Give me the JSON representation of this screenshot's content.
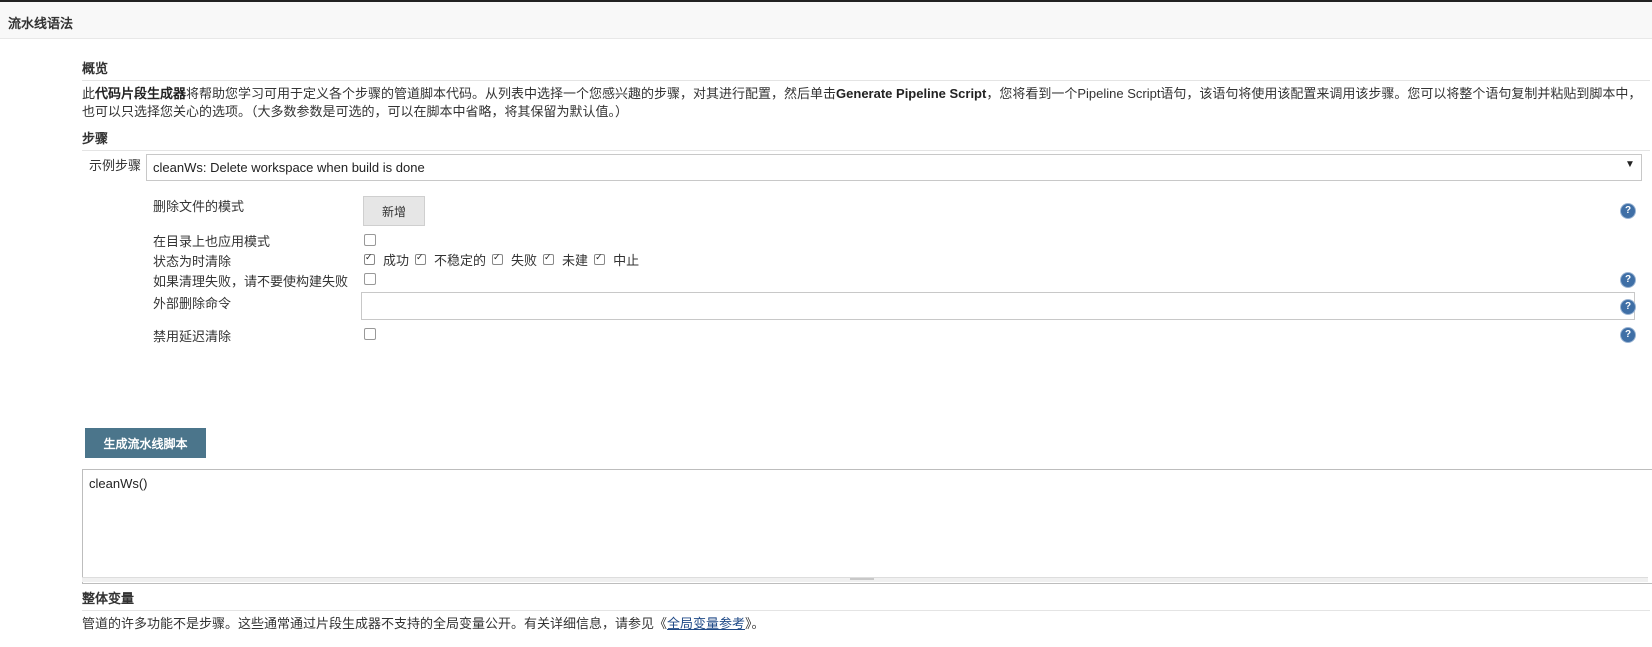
{
  "header": {
    "title": "流水线语法"
  },
  "overview": {
    "title": "概览",
    "text_pre": "此",
    "text_bold1": "代码片段生成器",
    "text_mid": "将帮助您学习可用于定义各个步骤的管道脚本代码。从列表中选择一个您感兴趣的步骤，对其进行配置，然后单击",
    "text_bold2": "Generate Pipeline Script",
    "text_post": "，您将看到一个Pipeline Script语句，该语句将使用该配置来调用该步骤。您可以将整个语句复制并粘贴到脚本中，也可以只选择您关心的选项。（大多数参数是可选的，可以在脚本中省略，将其保留为默认值。）"
  },
  "steps": {
    "title": "步骤",
    "sample_label": "示例步骤",
    "selected_step": "cleanWs: Delete workspace when build is done"
  },
  "form": {
    "patterns_label": "删除文件的模式",
    "add_button": "新增",
    "apply_dirs_label": "在目录上也应用模式",
    "apply_dirs_checked": false,
    "clean_when_label": "状态为时清除",
    "statuses": [
      {
        "label": "成功",
        "checked": true
      },
      {
        "label": "不稳定的",
        "checked": true
      },
      {
        "label": "失败",
        "checked": true
      },
      {
        "label": "未建",
        "checked": true
      },
      {
        "label": "中止",
        "checked": true
      }
    ],
    "not_fail_label": "如果清理失败，请不要使构建失败",
    "not_fail_checked": false,
    "external_cmd_label": "外部删除命令",
    "external_cmd_value": "",
    "disable_deferred_label": "禁用延迟清除",
    "disable_deferred_checked": false
  },
  "generate_button": "生成流水线脚本",
  "script_output": "cleanWs()",
  "globals": {
    "title": "整体变量",
    "text_pre": "管道的许多功能不是步骤。这些通常通过片段生成器不支持的全局变量公开。有关详细信息，请参见《",
    "link": "全局变量参考",
    "text_post": "》。"
  },
  "icons": {
    "help": "help-icon",
    "dropdown": "chevron-down-icon"
  },
  "colors": {
    "generate_button": "#4b758b",
    "help_icon": "#3f6fa6",
    "link": "#204a87"
  }
}
